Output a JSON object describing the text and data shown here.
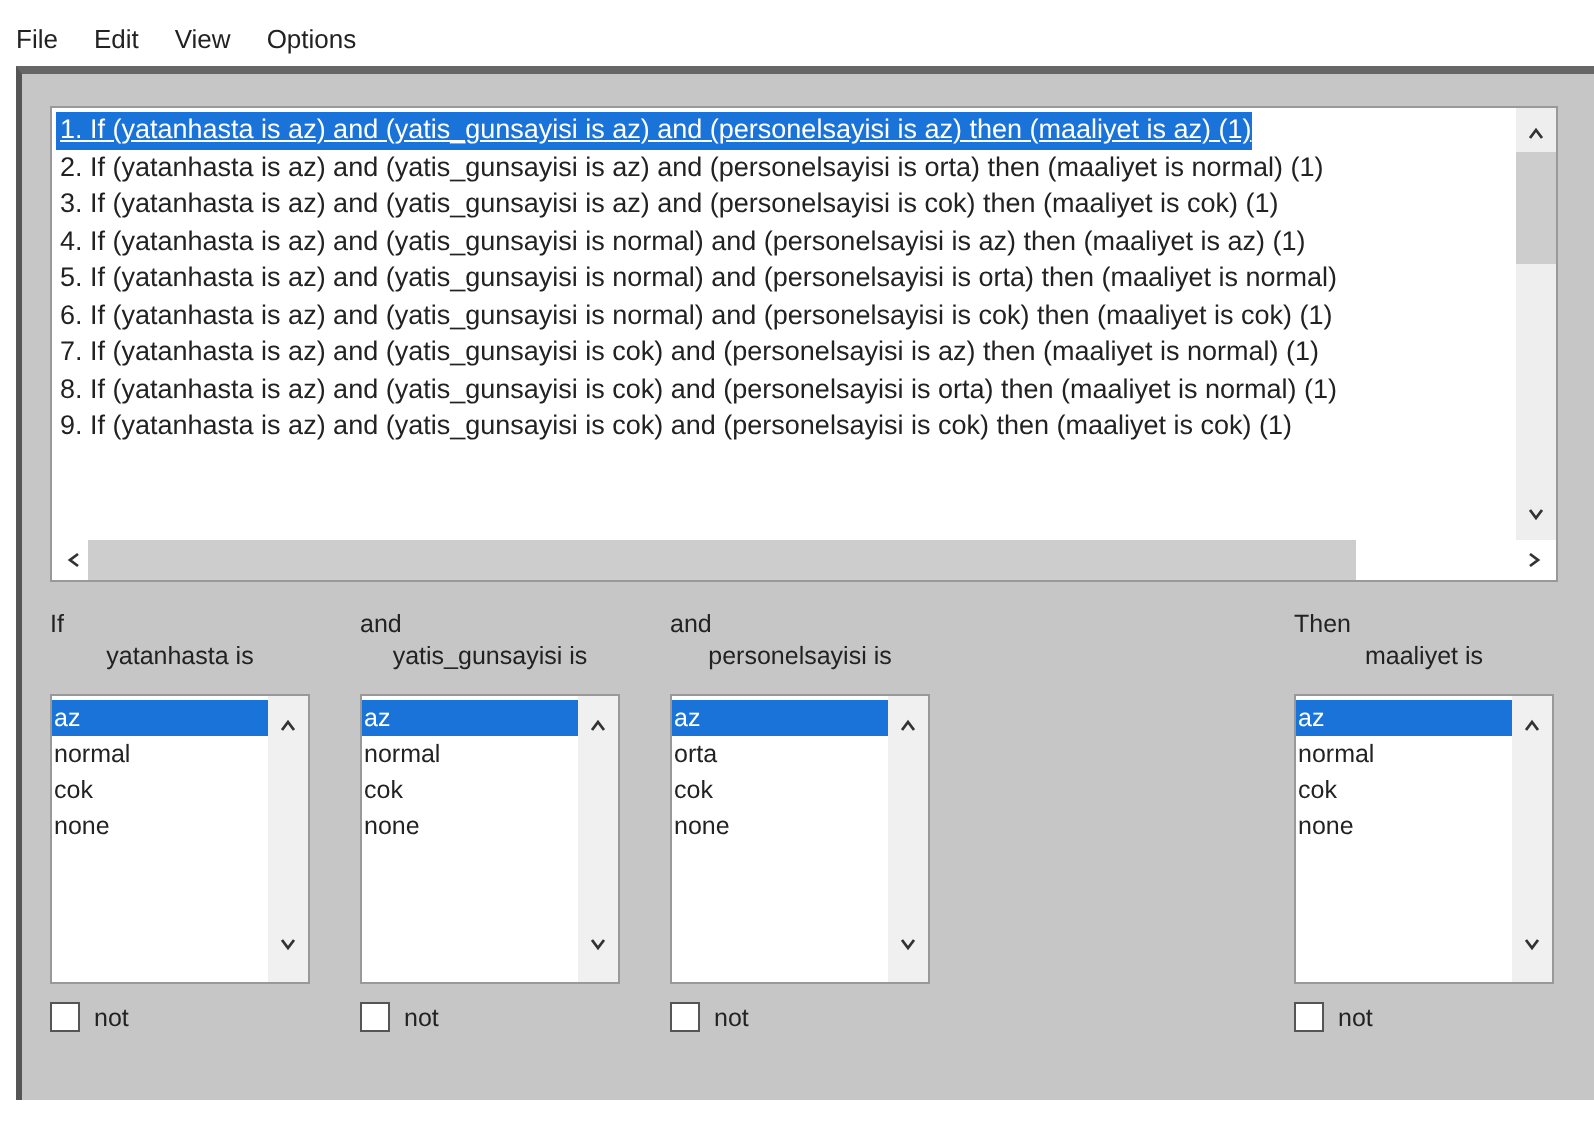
{
  "menu": [
    "File",
    "Edit",
    "View",
    "Options"
  ],
  "rules": [
    {
      "text": "1. If (yatanhasta is az) and (yatis_gunsayisi is az) and (personelsayisi is az) then (maaliyet is az) (1)",
      "selected": true
    },
    {
      "text": "2. If (yatanhasta is az) and (yatis_gunsayisi is az) and (personelsayisi is orta) then (maaliyet is normal) (1)",
      "selected": false
    },
    {
      "text": "3. If (yatanhasta is az) and (yatis_gunsayisi is az) and (personelsayisi is cok) then (maaliyet is cok) (1)",
      "selected": false
    },
    {
      "text": "4. If (yatanhasta is az) and (yatis_gunsayisi is normal) and (personelsayisi is az) then (maaliyet is az) (1)",
      "selected": false
    },
    {
      "text": "5. If (yatanhasta is az) and (yatis_gunsayisi is normal) and (personelsayisi is orta) then (maaliyet is normal)",
      "selected": false
    },
    {
      "text": "6. If (yatanhasta is az) and (yatis_gunsayisi is normal) and (personelsayisi is cok) then (maaliyet is cok) (1)",
      "selected": false
    },
    {
      "text": "7. If (yatanhasta is az) and (yatis_gunsayisi is cok) and (personelsayisi is az) then (maaliyet is normal) (1)",
      "selected": false
    },
    {
      "text": "8. If (yatanhasta is az) and (yatis_gunsayisi is cok) and (personelsayisi is orta) then (maaliyet is normal) (1)",
      "selected": false
    },
    {
      "text": "9. If (yatanhasta is az) and (yatis_gunsayisi is cok) and (personelsayisi is cok) then (maaliyet is cok) (1)",
      "selected": false
    }
  ],
  "columns": [
    {
      "kind": "antecedent",
      "connective": "If",
      "variable": "yatanhasta is",
      "options": [
        {
          "label": "az",
          "selected": true
        },
        {
          "label": "normal",
          "selected": false
        },
        {
          "label": "cok",
          "selected": false
        },
        {
          "label": "none",
          "selected": false
        }
      ],
      "not": {
        "label": "not",
        "checked": false
      }
    },
    {
      "kind": "antecedent",
      "connective": "and",
      "variable": "yatis_gunsayisi is",
      "options": [
        {
          "label": "az",
          "selected": true
        },
        {
          "label": "normal",
          "selected": false
        },
        {
          "label": "cok",
          "selected": false
        },
        {
          "label": "none",
          "selected": false
        }
      ],
      "not": {
        "label": "not",
        "checked": false
      }
    },
    {
      "kind": "antecedent",
      "connective": "and",
      "variable": "personelsayisi is",
      "options": [
        {
          "label": "az",
          "selected": true
        },
        {
          "label": "orta",
          "selected": false
        },
        {
          "label": "cok",
          "selected": false
        },
        {
          "label": "none",
          "selected": false
        }
      ],
      "not": {
        "label": "not",
        "checked": false
      }
    },
    {
      "kind": "consequent",
      "connective": "Then",
      "variable": "maaliyet is",
      "options": [
        {
          "label": "az",
          "selected": true
        },
        {
          "label": "normal",
          "selected": false
        },
        {
          "label": "cok",
          "selected": false
        },
        {
          "label": "none",
          "selected": false
        }
      ],
      "not": {
        "label": "not",
        "checked": false
      }
    }
  ]
}
